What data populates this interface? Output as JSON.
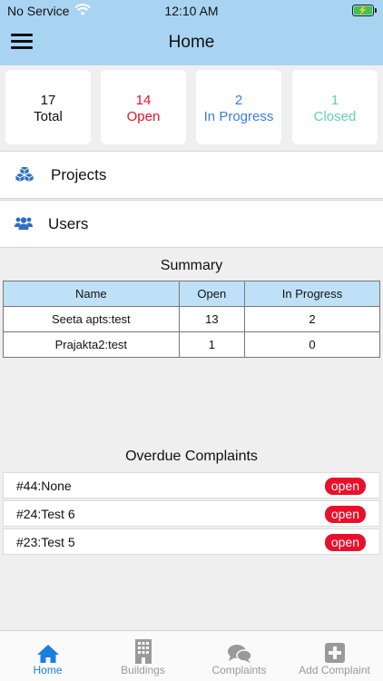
{
  "status_bar": {
    "carrier": "No Service",
    "time": "12:10 AM"
  },
  "header": {
    "title": "Home"
  },
  "stats": [
    {
      "count": "17",
      "label": "Total",
      "color": "#111111"
    },
    {
      "count": "14",
      "label": "Open",
      "color": "#e8102a"
    },
    {
      "count": "2",
      "label": "In Progress",
      "color": "#3a7fd8"
    },
    {
      "count": "1",
      "label": "Closed",
      "color": "#5fd2b4"
    }
  ],
  "nav": {
    "projects": "Projects",
    "users": "Users"
  },
  "summary": {
    "title": "Summary",
    "columns": [
      "Name",
      "Open",
      "In Progress"
    ],
    "rows": [
      [
        "Seeta apts:test",
        "13",
        "2"
      ],
      [
        "Prajakta2:test",
        "1",
        "0"
      ]
    ]
  },
  "overdue": {
    "title": "Overdue Complaints",
    "items": [
      {
        "text": "#44:None",
        "status": "open"
      },
      {
        "text": "#24:Test 6",
        "status": "open"
      },
      {
        "text": "#23:Test 5",
        "status": "open"
      }
    ]
  },
  "tabs": [
    {
      "label": "Home",
      "icon": "home-icon",
      "active": true
    },
    {
      "label": "Buildings",
      "icon": "building-icon",
      "active": false
    },
    {
      "label": "Complaints",
      "icon": "chat-bubbles-icon",
      "active": false
    },
    {
      "label": "Add Complaint",
      "icon": "plus-square-icon",
      "active": false
    }
  ],
  "colors": {
    "header_bg": "#a8d4f2",
    "accent": "#1b7de1",
    "badge": "#e8102a"
  }
}
